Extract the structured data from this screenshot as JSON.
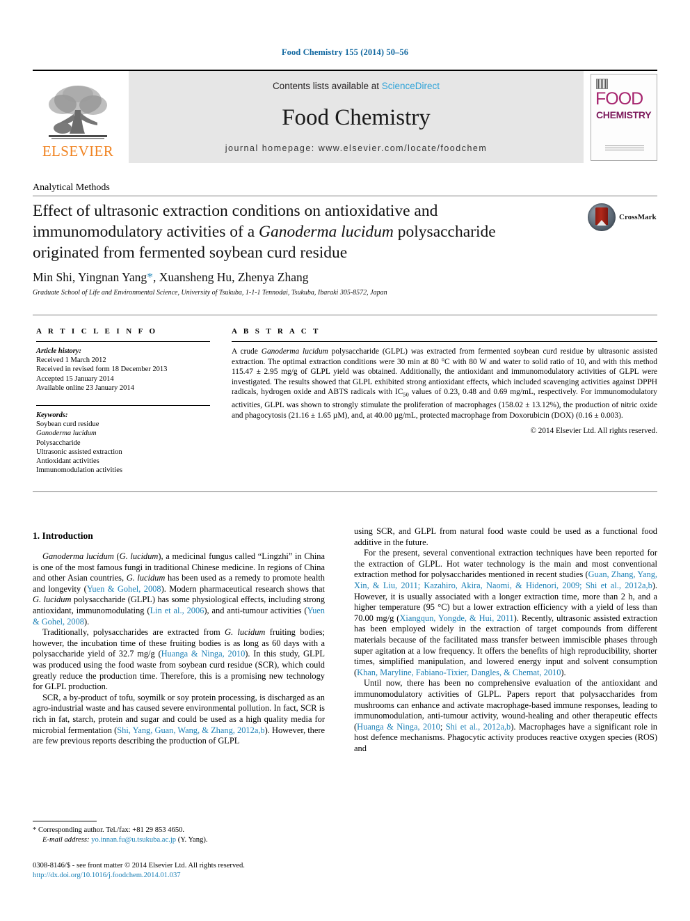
{
  "running_head": "Food Chemistry 155 (2014) 50–56",
  "masthead": {
    "publisher_name": "ELSEVIER",
    "contents_prefix": "Contents lists available at ",
    "sciencedirect": "ScienceDirect",
    "journal_name": "Food Chemistry",
    "homepage": "journal homepage: www.elsevier.com/locate/foodchem",
    "cover": {
      "food": "FOOD",
      "chemistry": "CHEMISTRY"
    },
    "link_color": "#2ea3d8",
    "elsevier_color": "#f08423"
  },
  "article": {
    "kind": "Analytical Methods",
    "title_part1": "Effect of ultrasonic extraction conditions on antioxidative and immunomodulatory activities of a ",
    "title_italic": "Ganoderma lucidum",
    "title_part2": " polysaccharide originated from fermented soybean curd residue",
    "authors": "Min Shi, Yingnan Yang",
    "authors_rest": ", Xuansheng Hu, Zhenya Zhang",
    "corresponding_marker": "*",
    "affiliation": "Graduate School of Life and Environmental Science, University of Tsukuba, 1-1-1 Tennodai, Tsukuba, Ibaraki 305-8572, Japan",
    "crossmark_label": "CrossMark"
  },
  "info": {
    "heading": "A R T I C L E   I N F O",
    "history_label": "Article history:",
    "history": [
      "Received 1 March 2012",
      "Received in revised form 18 December 2013",
      "Accepted 15 January 2014",
      "Available online 23 January 2014"
    ],
    "keywords_label": "Keywords:",
    "keywords": [
      "Soybean curd residue",
      "Ganoderma lucidum",
      "Polysaccharide",
      "Ultrasonic assisted extraction",
      "Antioxidant activities",
      "Immunomodulation activities"
    ]
  },
  "abstract": {
    "heading": "A B S T R A C T",
    "text_a": "A crude ",
    "text_italic": "Ganoderma lucidum",
    "text_b": " polysaccharide (GLPL) was extracted from fermented soybean curd residue by ultrasonic assisted extraction. The optimal extraction conditions were 30 min at 80 °C with 80 W and water to solid ratio of 10, and with this method 115.47 ± 2.95 mg/g of GLPL yield was obtained. Additionally, the antioxidant and immunomodulatory activities of GLPL were investigated. The results showed that GLPL exhibited strong antioxidant effects, which included scavenging activities against DPPH radicals, hydrogen oxide and ABTS radicals with IC",
    "sub": "50",
    "text_c": " values of 0.23, 0.48 and 0.69 mg/mL, respectively. For immunomodulatory activities, GLPL was shown to strongly stimulate the proliferation of macrophages (158.02 ± 13.12%), the production of nitric oxide and phagocytosis (21.16 ± 1.65 µM), and, at 40.00 µg/mL, protected macrophage from Doxorubicin (DOX) (0.16 ± 0.003).",
    "copyright": "© 2014 Elsevier Ltd. All rights reserved."
  },
  "body": {
    "section_heading": "1. Introduction",
    "left_p1_a": "Ganoderma lucidum",
    "left_p1_b": " (",
    "left_p1_c": "G. lucidum",
    "left_p1_d": "), a medicinal fungus called “Lingzhi” in China is one of the most famous fungi in traditional Chinese medicine. In regions of China and other Asian countries, ",
    "left_p1_e": "G. lucidum",
    "left_p1_f": " has been used as a remedy to promote health and longevity (",
    "left_p1_ref1": "Yuen & Gohel, 2008",
    "left_p1_g": "). Modern pharmaceutical research shows that ",
    "left_p1_h": "G. lucidum",
    "left_p1_i": " polysaccharide (GLPL) has some physiological effects, including strong antioxidant, immunomodulating (",
    "left_p1_ref2": "Lin et al., 2006",
    "left_p1_j": "), and anti-tumour activities (",
    "left_p1_ref3": "Yuen & Gohel, 2008",
    "left_p1_k": ").",
    "left_p2_a": "Traditionally, polysaccharides are extracted from ",
    "left_p2_b": "G. lucidum",
    "left_p2_c": " fruiting bodies; however, the incubation time of these fruiting bodies is as long as 60 days with a polysaccharide yield of 32.7 mg/g (",
    "left_p2_ref1": "Huanga & Ninga, 2010",
    "left_p2_d": "). In this study, GLPL was produced using the food waste from soybean curd residue (SCR), which could greatly reduce the production time. Therefore, this is a promising new technology for GLPL production.",
    "left_p3_a": "SCR, a by-product of tofu, soymilk or soy protein processing, is discharged as an agro-industrial waste and has caused severe environmental pollution. In fact, SCR is rich in fat, starch, protein and sugar and could be used as a high quality media for microbial fermentation (",
    "left_p3_ref1": "Shi, Yang, Guan, Wang, & Zhang, 2012a,b",
    "left_p3_b": "). However, there are few previous reports describing the production of GLPL",
    "right_p1": "using SCR, and GLPL from natural food waste could be used as a functional food additive in the future.",
    "right_p2_a": "For the present, several conventional extraction techniques have been reported for the extraction of GLPL. Hot water technology is the main and most conventional extraction method for polysaccharides mentioned in recent studies (",
    "right_p2_ref1": "Guan, Zhang, Yang, Xin, & Liu, 2011; Kazahiro, Akira, Naomi, & Hidenori, 2009; Shi et al., 2012a,b",
    "right_p2_b": "). However, it is usually associated with a longer extraction time, more than 2 h, and a higher temperature (95 °C) but a lower extraction efficiency with a yield of less than 70.00 mg/g (",
    "right_p2_ref2": "Xiangqun, Yongde, & Hui, 2011",
    "right_p2_c": "). Recently, ultrasonic assisted extraction has been employed widely in the extraction of target compounds from different materials because of the facilitated mass transfer between immiscible phases through super agitation at a low frequency. It offers the benefits of high reproducibility, shorter times, simplified manipulation, and lowered energy input and solvent consumption (",
    "right_p2_ref3": "Khan, Maryline, Fabiano-Tixier, Dangles, & Chemat, 2010",
    "right_p2_d": ").",
    "right_p3_a": "Until now, there has been no comprehensive evaluation of the antioxidant and immunomodulatory activities of GLPL. Papers report that polysaccharides from mushrooms can enhance and activate macrophage-based immune responses, leading to immunomodulation, anti-tumour activity, wound-healing and other therapeutic effects (",
    "right_p3_ref1": "Huanga & Ninga, 2010",
    "right_p3_mid": "; ",
    "right_p3_ref2": "Shi et al., 2012a,b",
    "right_p3_b": "). Macrophages have a significant role in host defence mechanisms. Phagocytic activity produces reactive oxygen species (ROS) and"
  },
  "footnote": {
    "marker": "*",
    "corresponding": " Corresponding author. Tel./fax: +81 29 853 4650.",
    "email_label": "E-mail address:",
    "email": "yo.innan.fu@u.tsukuba.ac.jp",
    "email_owner": " (Y. Yang)."
  },
  "footer": {
    "issn_line": "0308-8146/$ - see front matter © 2014 Elsevier Ltd. All rights reserved.",
    "doi": "http://dx.doi.org/10.1016/j.foodchem.2014.01.037"
  }
}
